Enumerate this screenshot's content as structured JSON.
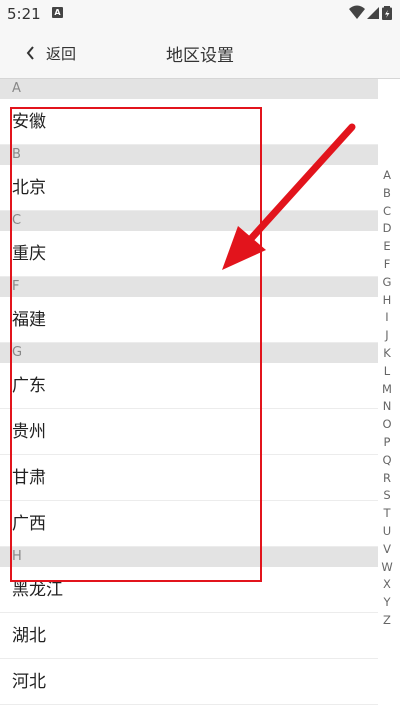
{
  "status_bar": {
    "time": "5:21",
    "notification_icon": "A"
  },
  "header": {
    "back_label": "返回",
    "title": "地区设置"
  },
  "sections": [
    {
      "letter": "A",
      "items": [
        "安徽"
      ]
    },
    {
      "letter": "B",
      "items": [
        "北京"
      ]
    },
    {
      "letter": "C",
      "items": [
        "重庆"
      ]
    },
    {
      "letter": "F",
      "items": [
        "福建"
      ]
    },
    {
      "letter": "G",
      "items": [
        "广东",
        "贵州",
        "甘肃",
        "广西"
      ]
    },
    {
      "letter": "H",
      "items": [
        "黑龙江",
        "湖北",
        "河北"
      ]
    }
  ],
  "alphabet_index": [
    "A",
    "B",
    "C",
    "D",
    "E",
    "F",
    "G",
    "H",
    "I",
    "J",
    "K",
    "L",
    "M",
    "N",
    "O",
    "P",
    "Q",
    "R",
    "S",
    "T",
    "U",
    "V",
    "W",
    "X",
    "Y",
    "Z"
  ],
  "colors": {
    "annotation_red": "#e2141c",
    "section_header_bg": "#e3e3e3",
    "header_bg": "#f7f7f7"
  },
  "icons": {
    "back": "chevron-left-icon",
    "wifi": "wifi-icon",
    "signal": "signal-icon",
    "battery": "battery-icon"
  }
}
